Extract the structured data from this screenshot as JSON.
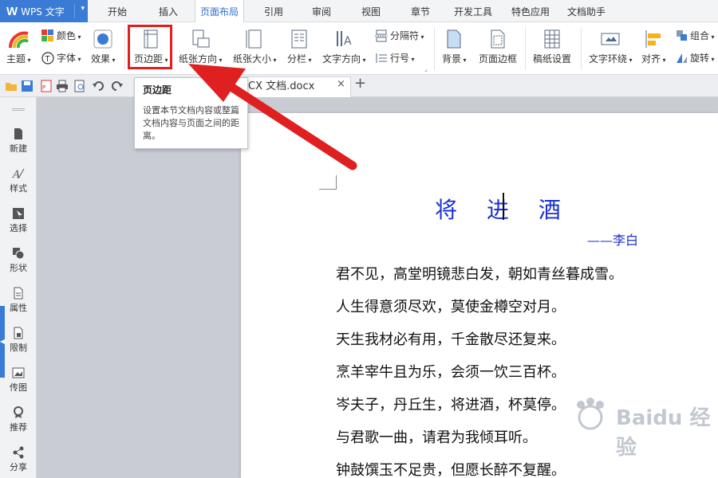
{
  "app": {
    "logo": "W",
    "name": "WPS 文字"
  },
  "menu": {
    "tabs": [
      "开始",
      "插入",
      "页面布局",
      "引用",
      "审阅",
      "视图",
      "章节",
      "开发工具",
      "特色应用",
      "文档助手"
    ],
    "active_tab": "页面布局"
  },
  "ribbon": {
    "theme": "主题",
    "color": "颜色",
    "font": "字体",
    "effect": "效果",
    "margins": "页边距",
    "orientation": "纸张方向",
    "size": "纸张大小",
    "columns": "分栏",
    "text_direction": "文字方向",
    "separator": "分隔符",
    "line_numbers": "行号",
    "background": "背景",
    "page_border": "页面边框",
    "manuscript": "稿纸设置",
    "text_wrap": "文字环绕",
    "align": "对齐",
    "group": "组合",
    "rotate": "旋转"
  },
  "document_tab": {
    "title": "CX 文档.docx",
    "close": "×",
    "new": "+"
  },
  "sidebar": {
    "items": [
      "新建",
      "样式",
      "选择",
      "形状",
      "属性",
      "限制",
      "传图",
      "推荐",
      "分享"
    ]
  },
  "tooltip": {
    "title": "页边距",
    "body": "设置本节文档内容或整篇文档内容与页面之间的距离。"
  },
  "document": {
    "title": "将 进 酒",
    "author": "——李白",
    "lines": [
      "君不见，高堂明镜悲白发，朝如青丝暮成雪。",
      "人生得意须尽欢，莫使金樽空对月。",
      "天生我材必有用，千金散尽还复来。",
      "烹羊宰牛且为乐，会须一饮三百杯。",
      "岑夫子，丹丘生，将进酒，杯莫停。",
      "与君歌一曲，请君为我倾耳听。",
      "钟鼓馔玉不足贵，但愿长醉不复醒。"
    ]
  },
  "watermark": "Baidu 经验",
  "colors": {
    "accent": "#3a7bd5",
    "highlight": "#e02020",
    "poem_title": "#1a2fd4"
  }
}
